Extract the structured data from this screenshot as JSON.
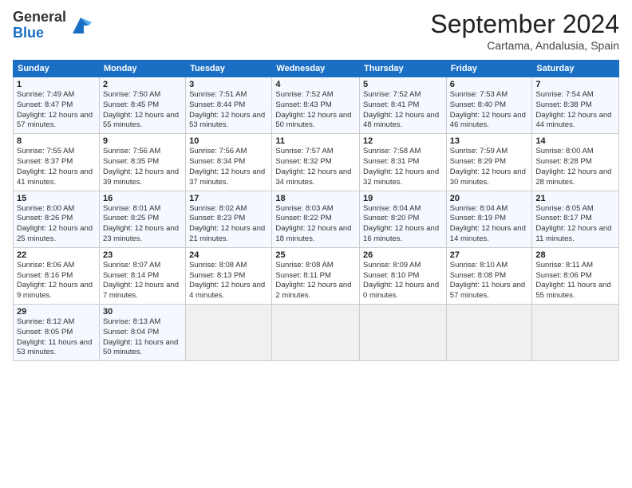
{
  "header": {
    "logo_general": "General",
    "logo_blue": "Blue",
    "month_title": "September 2024",
    "location": "Cartama, Andalusia, Spain"
  },
  "days_of_week": [
    "Sunday",
    "Monday",
    "Tuesday",
    "Wednesday",
    "Thursday",
    "Friday",
    "Saturday"
  ],
  "weeks": [
    [
      {
        "day": "1",
        "sunrise": "Sunrise: 7:49 AM",
        "sunset": "Sunset: 8:47 PM",
        "daylight": "Daylight: 12 hours and 57 minutes."
      },
      {
        "day": "2",
        "sunrise": "Sunrise: 7:50 AM",
        "sunset": "Sunset: 8:45 PM",
        "daylight": "Daylight: 12 hours and 55 minutes."
      },
      {
        "day": "3",
        "sunrise": "Sunrise: 7:51 AM",
        "sunset": "Sunset: 8:44 PM",
        "daylight": "Daylight: 12 hours and 53 minutes."
      },
      {
        "day": "4",
        "sunrise": "Sunrise: 7:52 AM",
        "sunset": "Sunset: 8:43 PM",
        "daylight": "Daylight: 12 hours and 50 minutes."
      },
      {
        "day": "5",
        "sunrise": "Sunrise: 7:52 AM",
        "sunset": "Sunset: 8:41 PM",
        "daylight": "Daylight: 12 hours and 48 minutes."
      },
      {
        "day": "6",
        "sunrise": "Sunrise: 7:53 AM",
        "sunset": "Sunset: 8:40 PM",
        "daylight": "Daylight: 12 hours and 46 minutes."
      },
      {
        "day": "7",
        "sunrise": "Sunrise: 7:54 AM",
        "sunset": "Sunset: 8:38 PM",
        "daylight": "Daylight: 12 hours and 44 minutes."
      }
    ],
    [
      {
        "day": "8",
        "sunrise": "Sunrise: 7:55 AM",
        "sunset": "Sunset: 8:37 PM",
        "daylight": "Daylight: 12 hours and 41 minutes."
      },
      {
        "day": "9",
        "sunrise": "Sunrise: 7:56 AM",
        "sunset": "Sunset: 8:35 PM",
        "daylight": "Daylight: 12 hours and 39 minutes."
      },
      {
        "day": "10",
        "sunrise": "Sunrise: 7:56 AM",
        "sunset": "Sunset: 8:34 PM",
        "daylight": "Daylight: 12 hours and 37 minutes."
      },
      {
        "day": "11",
        "sunrise": "Sunrise: 7:57 AM",
        "sunset": "Sunset: 8:32 PM",
        "daylight": "Daylight: 12 hours and 34 minutes."
      },
      {
        "day": "12",
        "sunrise": "Sunrise: 7:58 AM",
        "sunset": "Sunset: 8:31 PM",
        "daylight": "Daylight: 12 hours and 32 minutes."
      },
      {
        "day": "13",
        "sunrise": "Sunrise: 7:59 AM",
        "sunset": "Sunset: 8:29 PM",
        "daylight": "Daylight: 12 hours and 30 minutes."
      },
      {
        "day": "14",
        "sunrise": "Sunrise: 8:00 AM",
        "sunset": "Sunset: 8:28 PM",
        "daylight": "Daylight: 12 hours and 28 minutes."
      }
    ],
    [
      {
        "day": "15",
        "sunrise": "Sunrise: 8:00 AM",
        "sunset": "Sunset: 8:26 PM",
        "daylight": "Daylight: 12 hours and 25 minutes."
      },
      {
        "day": "16",
        "sunrise": "Sunrise: 8:01 AM",
        "sunset": "Sunset: 8:25 PM",
        "daylight": "Daylight: 12 hours and 23 minutes."
      },
      {
        "day": "17",
        "sunrise": "Sunrise: 8:02 AM",
        "sunset": "Sunset: 8:23 PM",
        "daylight": "Daylight: 12 hours and 21 minutes."
      },
      {
        "day": "18",
        "sunrise": "Sunrise: 8:03 AM",
        "sunset": "Sunset: 8:22 PM",
        "daylight": "Daylight: 12 hours and 18 minutes."
      },
      {
        "day": "19",
        "sunrise": "Sunrise: 8:04 AM",
        "sunset": "Sunset: 8:20 PM",
        "daylight": "Daylight: 12 hours and 16 minutes."
      },
      {
        "day": "20",
        "sunrise": "Sunrise: 8:04 AM",
        "sunset": "Sunset: 8:19 PM",
        "daylight": "Daylight: 12 hours and 14 minutes."
      },
      {
        "day": "21",
        "sunrise": "Sunrise: 8:05 AM",
        "sunset": "Sunset: 8:17 PM",
        "daylight": "Daylight: 12 hours and 11 minutes."
      }
    ],
    [
      {
        "day": "22",
        "sunrise": "Sunrise: 8:06 AM",
        "sunset": "Sunset: 8:16 PM",
        "daylight": "Daylight: 12 hours and 9 minutes."
      },
      {
        "day": "23",
        "sunrise": "Sunrise: 8:07 AM",
        "sunset": "Sunset: 8:14 PM",
        "daylight": "Daylight: 12 hours and 7 minutes."
      },
      {
        "day": "24",
        "sunrise": "Sunrise: 8:08 AM",
        "sunset": "Sunset: 8:13 PM",
        "daylight": "Daylight: 12 hours and 4 minutes."
      },
      {
        "day": "25",
        "sunrise": "Sunrise: 8:08 AM",
        "sunset": "Sunset: 8:11 PM",
        "daylight": "Daylight: 12 hours and 2 minutes."
      },
      {
        "day": "26",
        "sunrise": "Sunrise: 8:09 AM",
        "sunset": "Sunset: 8:10 PM",
        "daylight": "Daylight: 12 hours and 0 minutes."
      },
      {
        "day": "27",
        "sunrise": "Sunrise: 8:10 AM",
        "sunset": "Sunset: 8:08 PM",
        "daylight": "Daylight: 11 hours and 57 minutes."
      },
      {
        "day": "28",
        "sunrise": "Sunrise: 8:11 AM",
        "sunset": "Sunset: 8:06 PM",
        "daylight": "Daylight: 11 hours and 55 minutes."
      }
    ],
    [
      {
        "day": "29",
        "sunrise": "Sunrise: 8:12 AM",
        "sunset": "Sunset: 8:05 PM",
        "daylight": "Daylight: 11 hours and 53 minutes."
      },
      {
        "day": "30",
        "sunrise": "Sunrise: 8:13 AM",
        "sunset": "Sunset: 8:04 PM",
        "daylight": "Daylight: 11 hours and 50 minutes."
      },
      null,
      null,
      null,
      null,
      null
    ]
  ]
}
